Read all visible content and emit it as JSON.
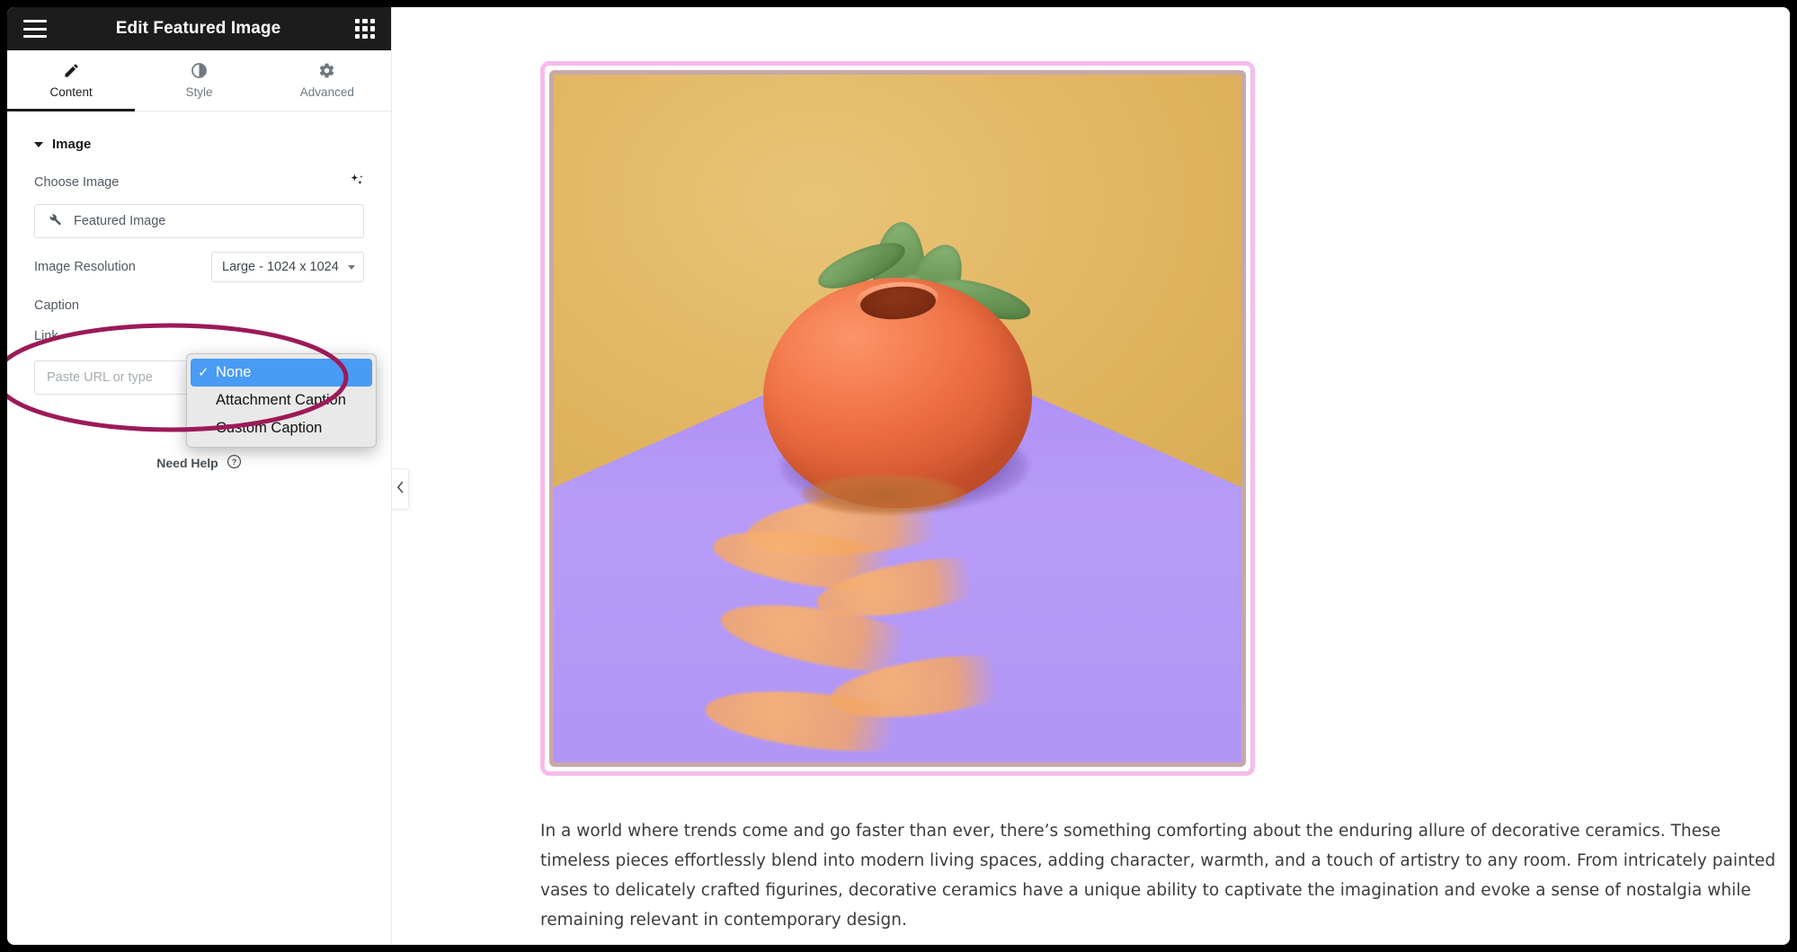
{
  "window": {
    "panel_title": "Edit Featured Image",
    "menu_icon": "hamburger-icon",
    "apps_icon": "grid-apps-icon"
  },
  "tabs": [
    {
      "label": "Content",
      "icon": "pencil-icon",
      "active": true
    },
    {
      "label": "Style",
      "icon": "contrast-icon",
      "active": false
    },
    {
      "label": "Advanced",
      "icon": "gear-icon",
      "active": false
    }
  ],
  "section": {
    "title": "Image",
    "collapse_icon": "caret-down-icon"
  },
  "controls": {
    "choose_image": {
      "label": "Choose Image",
      "ai_icon": "ai-sparkle-icon",
      "field_icon": "wrench-icon",
      "field_value": "Featured Image"
    },
    "image_resolution": {
      "label": "Image Resolution",
      "value": "Large - 1024 x 1024",
      "arrow_icon": "caret-down-icon"
    },
    "caption": {
      "label": "Caption",
      "value": "None"
    },
    "link": {
      "label": "Link",
      "url_value": "",
      "url_placeholder": "Paste URL or type",
      "dynamic_icon": "gear-dynamic-icon",
      "database_icon": "database-icon"
    }
  },
  "dropdown": {
    "check_glyph": "✓",
    "items": [
      {
        "label": "None",
        "selected": true
      },
      {
        "label": "Attachment Caption",
        "selected": false
      },
      {
        "label": "Custom Caption",
        "selected": false
      }
    ]
  },
  "help": {
    "label": "Need Help",
    "icon": "question-circle-icon"
  },
  "collapse_handle": {
    "icon": "chevron-left-icon"
  },
  "annotation": {
    "shape": "ellipse-highlight",
    "color": "#9c1a57"
  },
  "preview": {
    "featured_image": {
      "alt": "Orange spherical ceramic planter with a green succulent, on a purple surface with an orange sand trail, golden background",
      "outer_border_color": "#f3bdec",
      "inner_border_color": "#c7a8a8",
      "background_color": "#e0b35f",
      "floor_color": "#b195f6",
      "pot_color": "#f0703f",
      "sand_color": "#f3ab6e"
    },
    "article_text": "In a world where trends come and go faster than ever, there’s something comforting about the enduring allure of decorative ceramics. These timeless pieces effortlessly blend into modern living spaces, adding character, warmth, and a touch of artistry to any room. From intricately painted vases to delicately crafted figurines, decorative ceramics have a unique ability to captivate the imagination and evoke a sense of nostalgia while remaining relevant in contemporary design."
  }
}
